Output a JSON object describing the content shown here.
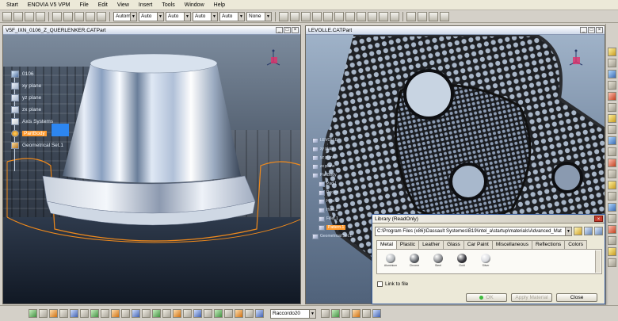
{
  "menu": {
    "items": [
      {
        "label": "Start",
        "accel": "S"
      },
      {
        "label": "ENOVIA V5 VPM",
        "accel": ""
      },
      {
        "label": "File",
        "accel": "F"
      },
      {
        "label": "Edit",
        "accel": "E"
      },
      {
        "label": "View",
        "accel": "V"
      },
      {
        "label": "Insert",
        "accel": "I"
      },
      {
        "label": "Tools",
        "accel": "T"
      },
      {
        "label": "Window",
        "accel": "W"
      },
      {
        "label": "Help",
        "accel": "H"
      }
    ]
  },
  "toolbar": {
    "combos": [
      "Automa",
      "Auto",
      "Auto",
      "Auto",
      "Auto",
      "None"
    ]
  },
  "left_window": {
    "title": "V5F_IXN_0106_Z_QUERLENKER.CATPart",
    "tree": [
      {
        "label": "0106",
        "icon": "part-root-icon"
      },
      {
        "label": "xy plane",
        "icon": "plane-icon"
      },
      {
        "label": "yz plane",
        "icon": "plane-icon"
      },
      {
        "label": "zx plane",
        "icon": "plane-icon"
      },
      {
        "label": "Axis Systems",
        "icon": "axis-system-icon"
      },
      {
        "label": "PartBody",
        "icon": "part-body-icon",
        "selected": true
      },
      {
        "label": "Geometrical Set.1",
        "icon": "geometrical-set-icon"
      }
    ]
  },
  "right_window": {
    "title": "LEVOLLE.CATPart",
    "tree": [
      {
        "label": "LEVOLLE"
      },
      {
        "label": "xy plane"
      },
      {
        "label": "yz plane"
      },
      {
        "label": "zx plane"
      },
      {
        "label": "PartBody"
      },
      {
        "label": "Pad.1"
      },
      {
        "label": "Pocket.1"
      },
      {
        "label": "Hole.1"
      },
      {
        "label": "Hole.2"
      },
      {
        "label": "Fillet.1"
      },
      {
        "label": "Pattern.1",
        "selected": true
      },
      {
        "label": "Geometrical Set.1"
      }
    ]
  },
  "library_dialog": {
    "title": "Library (ReadOnly)",
    "path": "C:\\Program Files (x86)\\Dassault Systemes\\B19\\intel_a\\startup\\materials\\Advanced_Mat",
    "tabs": [
      "Metal",
      "Plastic",
      "Leather",
      "Glass",
      "Car Paint",
      "Miscellaneous",
      "Reflections",
      "Colors"
    ],
    "active_tab": "Metal",
    "materials": [
      {
        "name": "Aluminium",
        "color": "#b0b4b8"
      },
      {
        "name": "Chrome",
        "color": "#6a6e74"
      },
      {
        "name": "Steel",
        "color": "#8a8c90"
      },
      {
        "name": "Gold",
        "color": "#3a3a40"
      },
      {
        "name": "Silver",
        "color": "#d8dadf"
      }
    ],
    "link_label": "Link to file",
    "buttons": {
      "ok": "OK",
      "apply": "Apply Material",
      "close": "Close"
    }
  },
  "bottombar": {
    "combo": "Raccordo20"
  }
}
